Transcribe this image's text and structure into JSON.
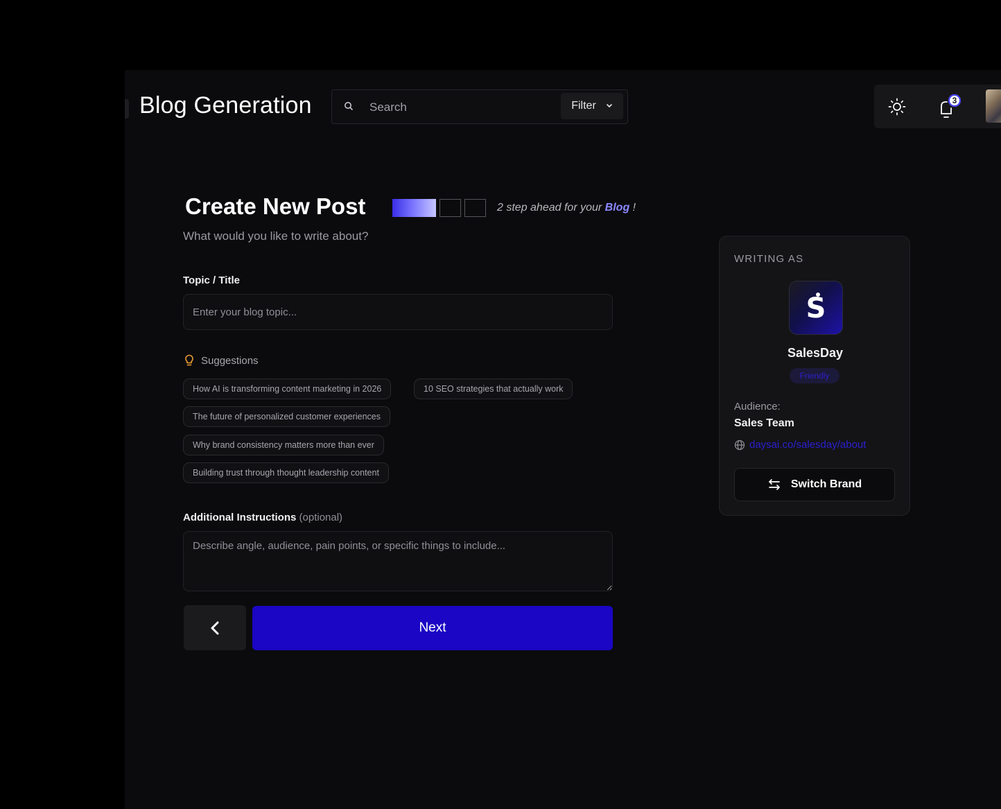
{
  "header": {
    "title": "Blog Generation",
    "search_placeholder": "Search",
    "filter_label": "Filter",
    "notification_count": "3"
  },
  "form": {
    "title": "Create New Post",
    "step_note_prefix": "2 step  ahead for your",
    "step_note_highlight": "Blog",
    "step_note_suffix": " !",
    "subtitle": "What would you like to write about?",
    "topic_label": "Topic / Title",
    "topic_placeholder": "Enter your blog topic...",
    "suggestions_label": "Suggestions",
    "suggestions": [
      "How AI is transforming content marketing in 2026",
      "10 SEO strategies that actually work",
      "The future of personalized customer experiences",
      "Why brand consistency matters more than ever",
      "Building trust through thought leadership content"
    ],
    "instructions_label": "Additional Instructions",
    "instructions_optional": "(optional)",
    "instructions_placeholder": "Describe angle, audience, pain points, or specific things to include...",
    "next_label": "Next"
  },
  "steps": {
    "current": 1,
    "total": 3
  },
  "brand_card": {
    "heading": "WRITING AS",
    "logo_letter": "S",
    "name": "SalesDay",
    "tone": "Friendly",
    "audience_label": "Audience:",
    "audience_value": "Sales Team",
    "link": "daysai.co/salesday/about",
    "switch_label": "Switch Brand"
  },
  "colors": {
    "accent": "#1a06c4",
    "link": "#2b1fd0",
    "background": "#0b0b0d"
  }
}
